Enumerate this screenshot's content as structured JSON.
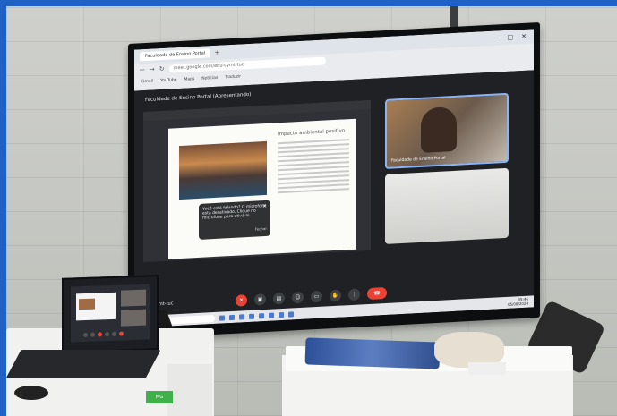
{
  "browser": {
    "tabs": [
      "Faculdade de Ensino Portal"
    ],
    "url": "meet.google.com/ebu-cymt-tuc",
    "window_controls": [
      "–",
      "□",
      "✕"
    ],
    "bookmarks": [
      "Gmail",
      "YouTube",
      "Maps",
      "Notícias",
      "Traduzir"
    ]
  },
  "meet": {
    "presenter_title": "Faculdade de Ensino Portal (Apresentando)",
    "meeting_code": "ebu-cymt-tuc",
    "slide_heading": "Impacto ambiental positivo",
    "mic_popup": {
      "text": "Você está falando? O microfone está desativado. Clique no microfone para ativá-lo.",
      "action": "Fechar",
      "close": "✕"
    },
    "tiles": [
      {
        "label": "Faculdade de Ensino Portal"
      },
      {
        "label": ""
      }
    ],
    "control_icons": [
      "hand-icon",
      "mic-off-icon",
      "camera-icon",
      "captions-icon",
      "emoji-icon",
      "present-icon",
      "raise-hand-icon",
      "more-icon",
      "end-call-icon"
    ]
  },
  "taskbar": {
    "search_placeholder": "Pesquisar",
    "lang": "POR\nPTB2",
    "time": "05:46",
    "date": "05/08/2024"
  },
  "sticker": "MG"
}
